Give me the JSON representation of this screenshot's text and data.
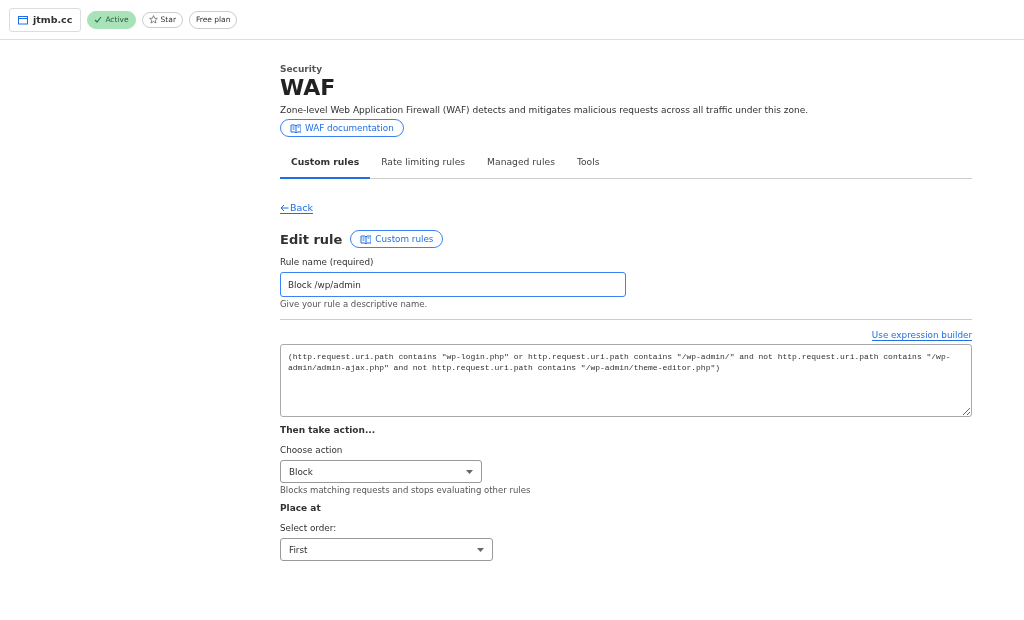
{
  "top_bar": {
    "zone": "jtmb.cc",
    "badges": [
      {
        "kind": "status",
        "label": "Active"
      },
      {
        "kind": "star",
        "label": "Star"
      },
      {
        "kind": "plain",
        "label": "Free plan"
      }
    ]
  },
  "header": {
    "section": "Security",
    "title": "WAF",
    "description": "Zone-level Web Application Firewall (WAF) detects and mitigates malicious requests across all traffic under this zone.",
    "doc_link": "WAF documentation"
  },
  "tabs": [
    {
      "label": "Custom rules",
      "selected": true
    },
    {
      "label": "Rate limiting rules",
      "selected": false
    },
    {
      "label": "Managed rules",
      "selected": false
    },
    {
      "label": "Tools",
      "selected": false
    }
  ],
  "back_link": "Back",
  "edit": {
    "title": "Edit rule",
    "doc_link": "Custom rules",
    "name_label": "Rule name (required)",
    "name_value": "Block /wp/admin",
    "name_hint": "Give your rule a descriptive name.",
    "builder_link": "Use expression builder",
    "expression": "(http.request.uri.path contains \"wp-login.php\" or http.request.uri.path contains \"/wp-admin/\" and not http.request.uri.path contains \"/wp-admin/admin-ajax.php\" and not http.request.uri.path contains \"/wp-admin/theme-editor.php\")"
  },
  "action": {
    "heading": "Then take action...",
    "label": "Choose action",
    "value": "Block",
    "hint": "Blocks matching requests and stops evaluating other rules"
  },
  "place": {
    "heading": "Place at",
    "label": "Select order:",
    "value": "First"
  }
}
